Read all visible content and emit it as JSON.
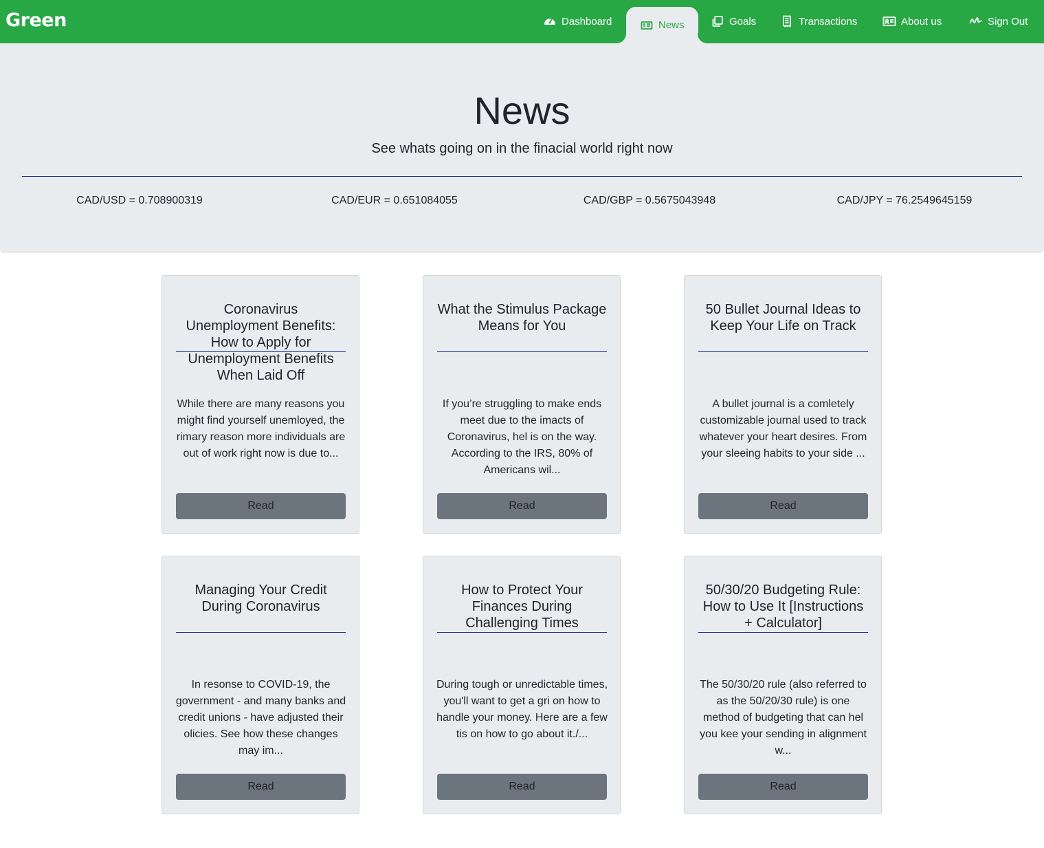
{
  "brand": "Green",
  "nav": {
    "items": [
      {
        "label": "Dashboard",
        "icon": "dashboard-gauge-icon"
      },
      {
        "label": "News",
        "icon": "newspaper-icon",
        "active": true
      },
      {
        "label": "Goals",
        "icon": "goals-copy-icon"
      },
      {
        "label": "Transactions",
        "icon": "receipt-icon"
      },
      {
        "label": "About us",
        "icon": "contact-card-icon"
      },
      {
        "label": "Sign Out",
        "icon": "signature-icon"
      }
    ]
  },
  "header": {
    "title": "News",
    "subtitle": "See whats going on in the finacial world right now"
  },
  "rates": [
    "CAD/USD = 0.708900319",
    "CAD/EUR = 0.651084055",
    "CAD/GBP = 0.5675043948",
    "CAD/JPY = 76.2549645159"
  ],
  "articles": [
    {
      "title": "Coronavirus Unemployment Benefits: How to Apply for Unemployment Benefits When Laid Off",
      "summary": "While there are many reasons you might find yourself unemloyed, the rimary reason more individuals are out of work right now is due to...",
      "button": "Read"
    },
    {
      "title": "What the Stimulus Package Means for You",
      "summary": "If you’re struggling to make ends meet due to the imacts of Coronavirus, hel is on the way. According to the IRS, 80% of Americans wil...",
      "button": "Read"
    },
    {
      "title": "50 Bullet Journal Ideas to Keep Your Life on Track",
      "summary": "A bullet journal is a comletely customizable journal used to track whatever your heart desires. From your sleeing habits to your side ...",
      "button": "Read"
    },
    {
      "title": "Managing Your Credit During Coronavirus",
      "summary": "In resonse to COVID-19, the government - and many banks and credit unions - have adjusted their olicies. See how these changes may im...",
      "button": "Read"
    },
    {
      "title": "How to Protect Your Finances During Challenging Times",
      "summary": "During tough or unredictable times, you'll want to get a gri on how to handle your money. Here are a few tis on how to go about it./...",
      "button": "Read"
    },
    {
      "title": "50/30/20 Budgeting Rule: How to Use It [Instructions + Calculator]",
      "summary": "The 50/30/20 rule (also referred to as the 50/20/30 rule) is one method of budgeting that can hel you kee your sending in alignment w...",
      "button": "Read"
    }
  ],
  "colors": {
    "brand_green": "#28a745",
    "jumbotron_bg": "#e9ecef",
    "rule_navy": "#1e2a8a",
    "button_gray": "#6c757d"
  }
}
